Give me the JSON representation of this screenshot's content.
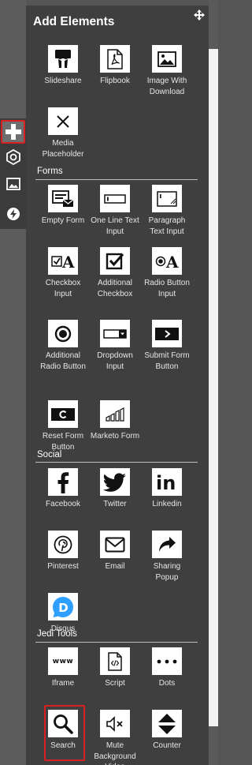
{
  "panel": {
    "title": "Add Elements"
  },
  "sections": [
    {
      "label": "",
      "items": [
        {
          "label": "Slideshare",
          "icon": "slideshare-icon"
        },
        {
          "label": "Flipbook",
          "icon": "pdf-icon"
        },
        {
          "label": "Image With Download",
          "icon": "image-icon"
        },
        {
          "label": "Media Placeholder",
          "icon": "close-icon"
        }
      ]
    },
    {
      "label": "Forms",
      "items": [
        {
          "label": "Empty Form",
          "icon": "form-icon"
        },
        {
          "label": "One Line Text Input",
          "icon": "text-input-icon"
        },
        {
          "label": "Paragraph Text Input",
          "icon": "paragraph-icon"
        },
        {
          "label": "Checkbox Input",
          "icon": "checkbox-input-icon"
        },
        {
          "label": "Additional Checkbox",
          "icon": "checkbox-icon"
        },
        {
          "label": "Radio Button Input",
          "icon": "radio-input-icon"
        },
        {
          "label": "Additional Radio Button",
          "icon": "radio-icon"
        },
        {
          "label": "Dropdown Input",
          "icon": "dropdown-icon"
        },
        {
          "label": "Submit Form Button",
          "icon": "submit-icon"
        },
        {
          "label": "Reset Form Button",
          "icon": "reset-icon"
        },
        {
          "label": "Marketo Form",
          "icon": "marketo-icon"
        }
      ]
    },
    {
      "label": "Social",
      "items": [
        {
          "label": "Facebook",
          "icon": "facebook-icon"
        },
        {
          "label": "Twitter",
          "icon": "twitter-icon"
        },
        {
          "label": "Linkedin",
          "icon": "linkedin-icon"
        },
        {
          "label": "Pinterest",
          "icon": "pinterest-icon"
        },
        {
          "label": "Email",
          "icon": "email-icon"
        },
        {
          "label": "Sharing Popup",
          "icon": "share-icon"
        },
        {
          "label": "Disqus",
          "icon": "disqus-icon"
        }
      ]
    },
    {
      "label": "Jedi Tools",
      "items": [
        {
          "label": "Iframe",
          "icon": "iframe-icon",
          "text": "www"
        },
        {
          "label": "Script",
          "icon": "script-icon"
        },
        {
          "label": "Dots",
          "icon": "dots-icon"
        },
        {
          "label": "Search",
          "icon": "search-icon",
          "selected": true
        },
        {
          "label": "Mute Background Video",
          "icon": "mute-icon"
        },
        {
          "label": "Counter",
          "icon": "counter-icon"
        }
      ]
    }
  ],
  "colors": {
    "selection": "#d92020",
    "panel": "#3f3f3f",
    "disqus": "#2e9fff"
  }
}
